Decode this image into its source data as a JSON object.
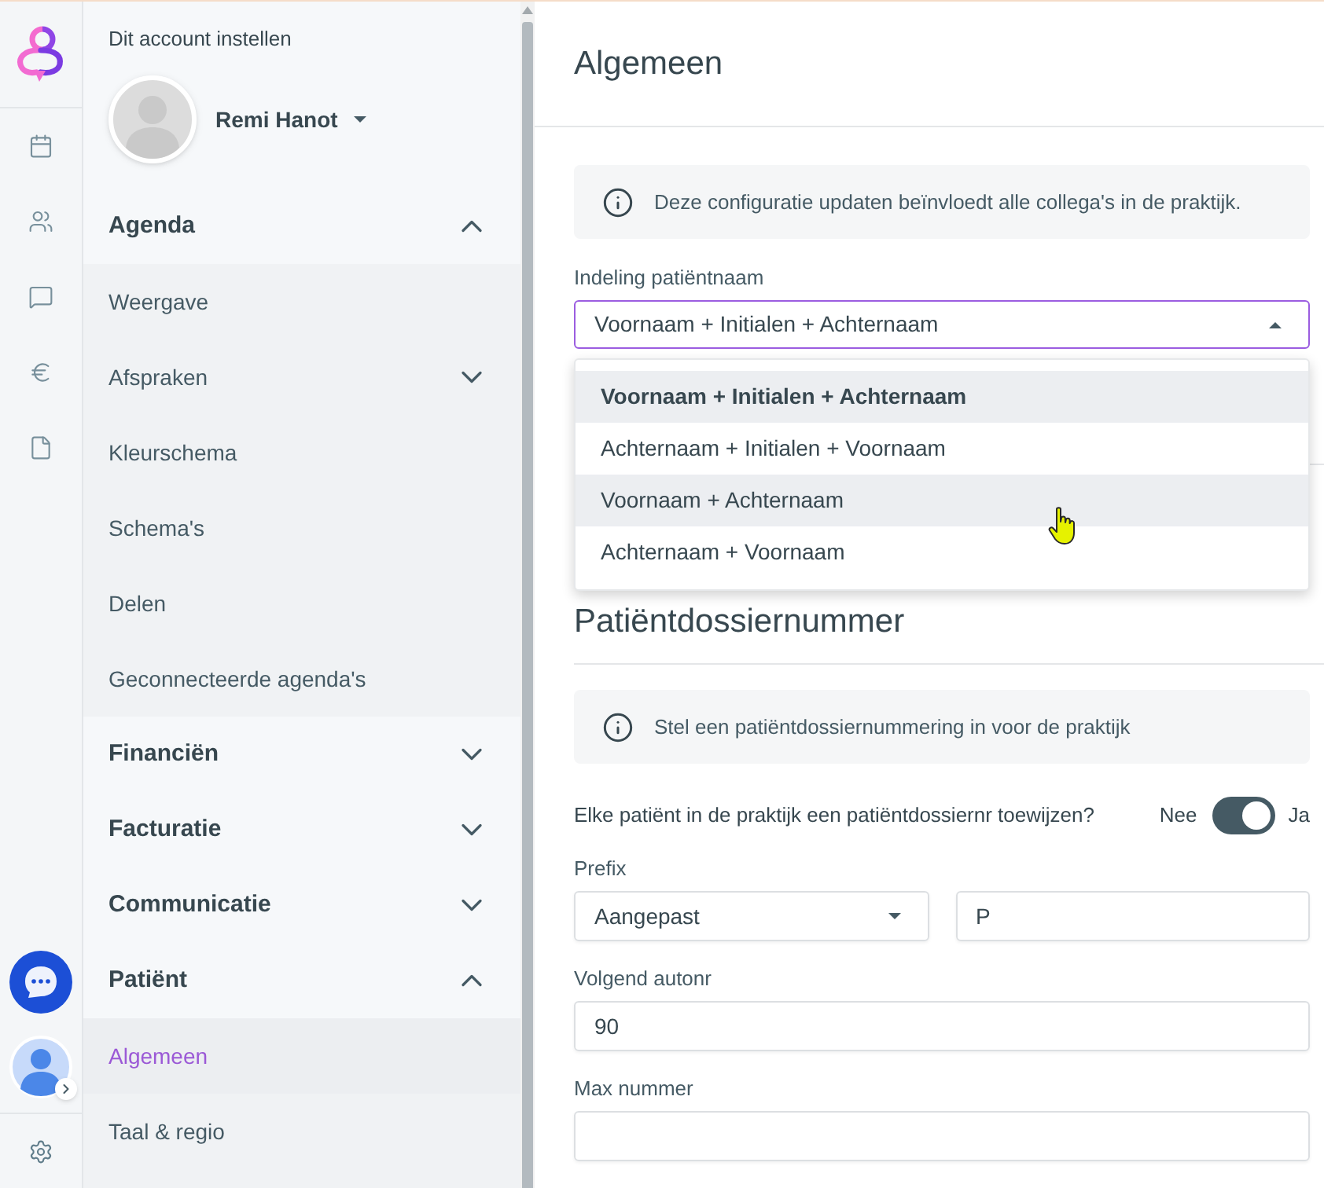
{
  "sidebar": {
    "title": "Dit account instellen",
    "user": {
      "name": "Remi Hanot"
    },
    "sections": [
      {
        "label": "Agenda",
        "expanded": true,
        "items": [
          {
            "label": "Weergave",
            "kind": "link",
            "selected": false
          },
          {
            "label": "Afspraken",
            "kind": "group",
            "expanded": false,
            "selected": false
          },
          {
            "label": "Kleurschema",
            "kind": "link",
            "selected": false
          },
          {
            "label": "Schema's",
            "kind": "link",
            "selected": false
          },
          {
            "label": "Delen",
            "kind": "link",
            "selected": false
          },
          {
            "label": "Geconnecteerde agenda's",
            "kind": "link",
            "selected": false
          }
        ]
      },
      {
        "label": "Financiën",
        "expanded": false
      },
      {
        "label": "Facturatie",
        "expanded": false
      },
      {
        "label": "Communicatie",
        "expanded": false
      },
      {
        "label": "Patiënt",
        "expanded": true,
        "items": [
          {
            "label": "Algemeen",
            "kind": "link",
            "selected": true
          },
          {
            "label": "Taal & regio",
            "kind": "link",
            "selected": false
          }
        ]
      }
    ]
  },
  "page": {
    "title": "Algemeen"
  },
  "name_format": {
    "info": "Deze configuratie updaten beïnvloedt alle collega's in de praktijk.",
    "label": "Indeling patiëntnaam",
    "value": "Voornaam + Initialen + Achternaam",
    "open": true,
    "options": [
      {
        "label": "Voornaam + Initialen + Achternaam",
        "selected": true,
        "highlighted": true
      },
      {
        "label": "Achternaam + Initialen + Voornaam",
        "selected": false,
        "highlighted": false
      },
      {
        "label": "Voornaam + Achternaam",
        "selected": false,
        "highlighted": true
      },
      {
        "label": "Achternaam + Voornaam",
        "selected": false,
        "highlighted": false
      }
    ]
  },
  "dossier": {
    "title": "Patiëntdossiernummer",
    "info": "Stel een patiëntdossiernummering in voor de praktijk",
    "assign": {
      "label": "Elke patiënt in de praktijk een patiëntdossiernr toewijzen?",
      "off_label": "Nee",
      "on_label": "Ja",
      "on": true
    },
    "prefix": {
      "label": "Prefix",
      "mode": "Aangepast",
      "value": "P"
    },
    "next": {
      "label": "Volgend autonr",
      "value": "90"
    },
    "max": {
      "label": "Max nummer"
    }
  }
}
